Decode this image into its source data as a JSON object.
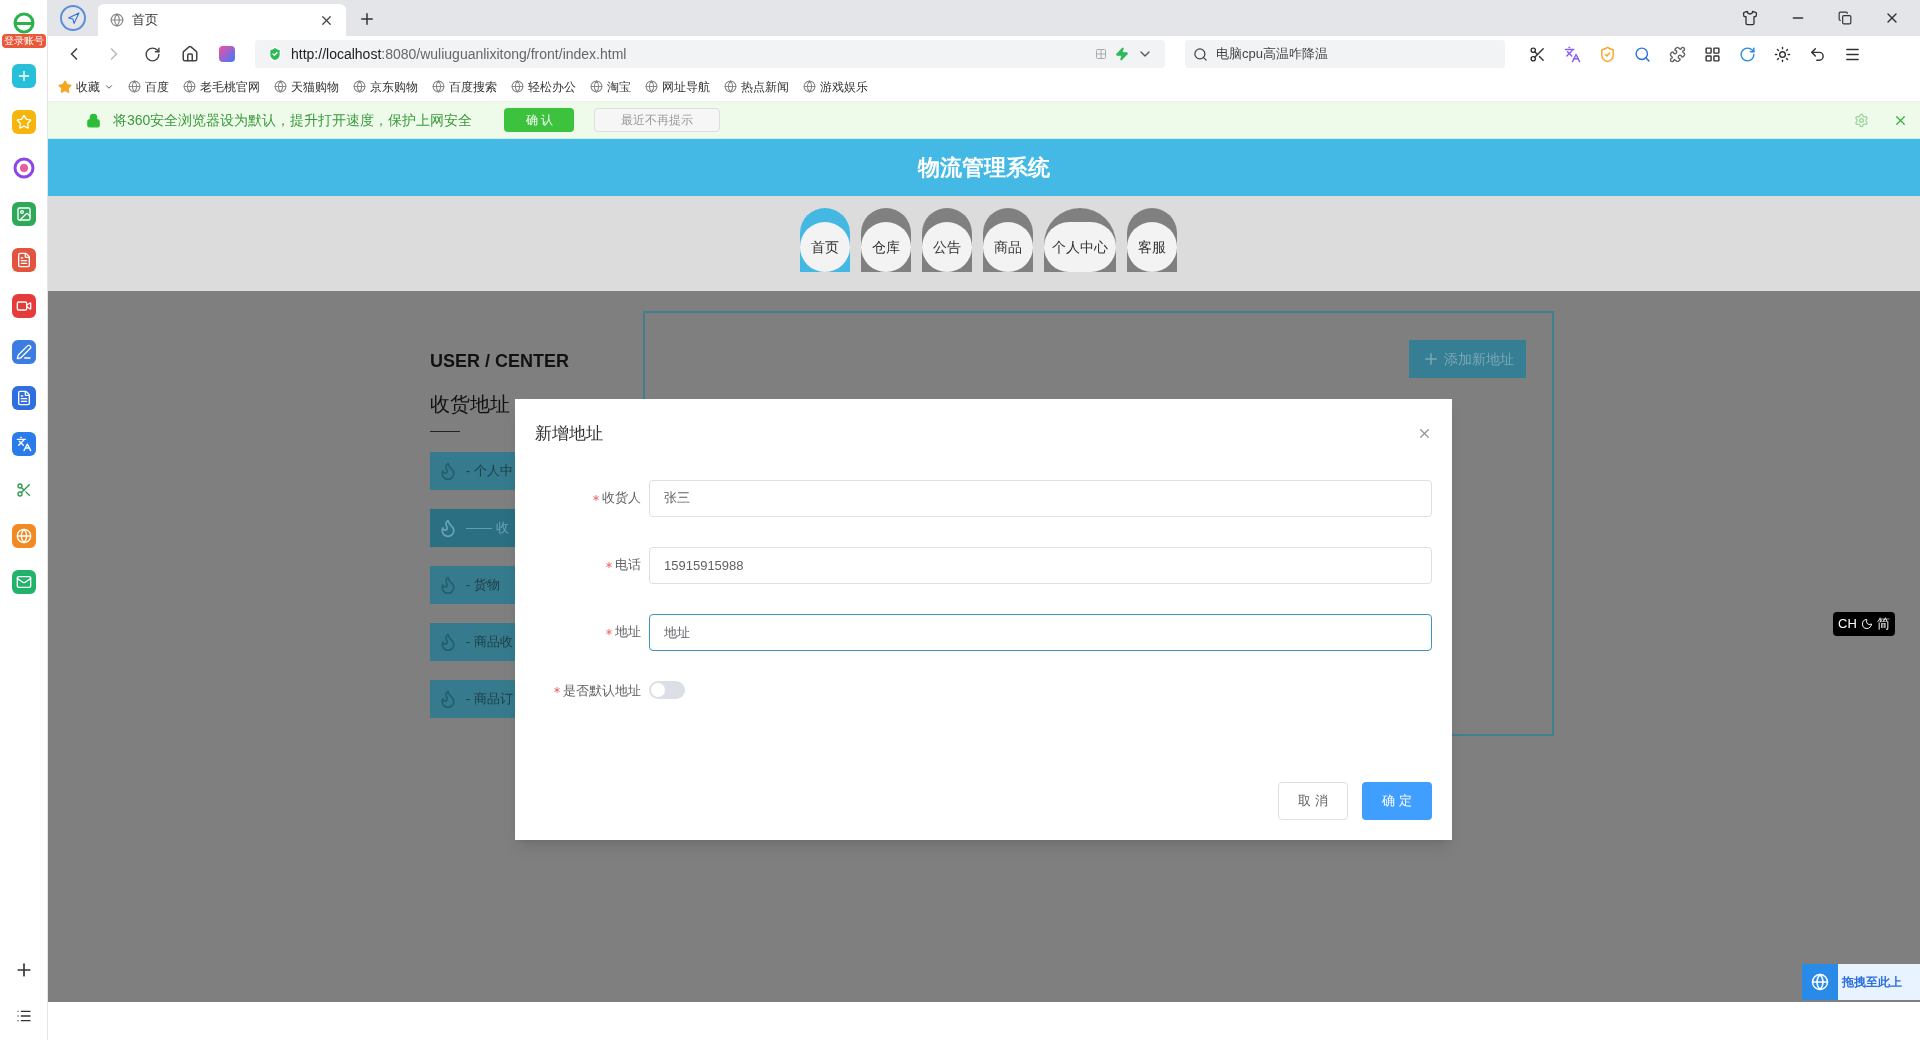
{
  "side_panel": {
    "login_badge": "登录账号"
  },
  "browser": {
    "tabs": [
      {
        "title": "首页",
        "selected": true
      }
    ],
    "url": {
      "host": "http://localhost",
      "rest": ":8080/wuliuguanlixitong/front/index.html"
    },
    "search": {
      "placeholder": "电脑cpu高温咋降温"
    },
    "bookmarks": [
      "收藏",
      "百度",
      "老毛桃官网",
      "天猫购物",
      "京东购物",
      "百度搜索",
      "轻松办公",
      "淘宝",
      "网址导航",
      "热点新闻",
      "游戏娱乐"
    ],
    "notification": {
      "message": "将360安全浏览器设为默认，提升打开速度，保护上网安全",
      "confirm": "确 认",
      "dismiss": "最近不再提示"
    }
  },
  "page": {
    "title": "物流管理系统",
    "nav": [
      {
        "label": "首页",
        "selected": true
      },
      {
        "label": "仓库",
        "selected": false
      },
      {
        "label": "公告",
        "selected": false
      },
      {
        "label": "商品",
        "selected": false
      },
      {
        "label": "个人中心",
        "selected": false
      },
      {
        "label": "客服",
        "selected": false
      }
    ],
    "section_title_en": "USER / CENTER",
    "section_title": "收货地址",
    "menu": [
      {
        "label": "- 个人中",
        "selected": false
      },
      {
        "label": "—— 收",
        "selected": true
      },
      {
        "label": "- 货物",
        "selected": false
      },
      {
        "label": "- 商品收",
        "selected": false
      },
      {
        "label": "- 商品订",
        "selected": false
      }
    ],
    "add_button": "添加新地址"
  },
  "dialog": {
    "title": "新增地址",
    "fields": [
      {
        "kind": "input",
        "label": "收货人",
        "required": true,
        "value": "张三",
        "focused": false
      },
      {
        "kind": "input",
        "label": "电话",
        "required": true,
        "value": "15915915988",
        "focused": false
      },
      {
        "kind": "input",
        "label": "地址",
        "required": true,
        "placeholder": "地址",
        "focused": true
      },
      {
        "kind": "switch",
        "label": "是否默认地址",
        "required": true,
        "on": false
      }
    ],
    "buttons": [
      {
        "label": "取 消",
        "primary": false
      },
      {
        "label": "确 定",
        "primary": true
      }
    ]
  },
  "ime": {
    "mode": "CH",
    "script": "简"
  },
  "upload_widget": {
    "label": "拖拽至此上"
  }
}
